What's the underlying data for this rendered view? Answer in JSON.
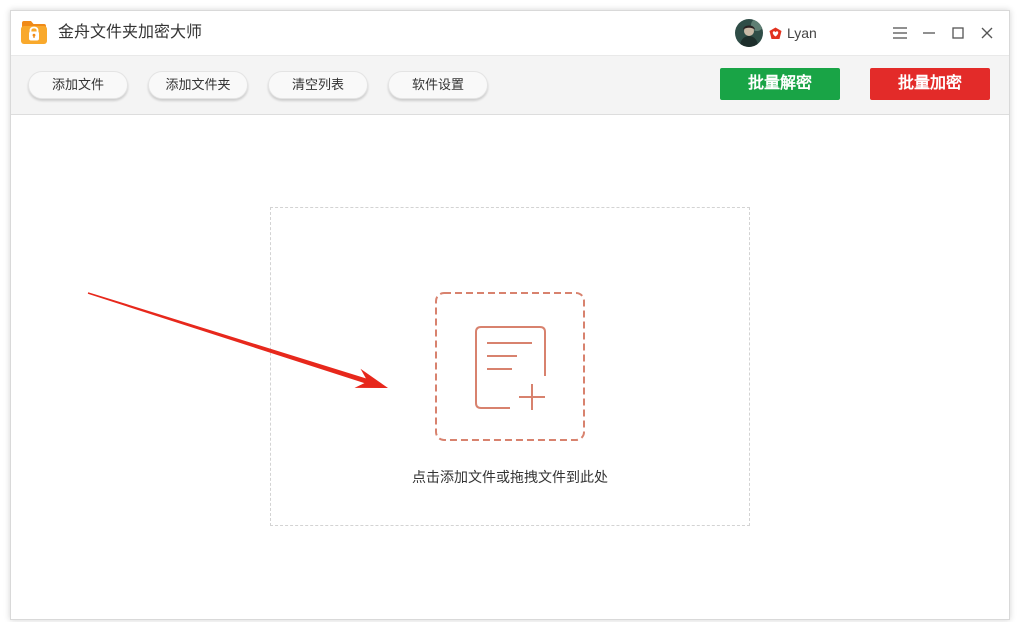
{
  "window": {
    "title": "金舟文件夹加密大师",
    "username": "Lyan"
  },
  "toolbar": {
    "buttons": [
      {
        "label": "添加文件"
      },
      {
        "label": "添加文件夹"
      },
      {
        "label": "清空列表"
      },
      {
        "label": "软件设置"
      }
    ],
    "decrypt_label": "批量解密",
    "encrypt_label": "批量加密"
  },
  "dropzone": {
    "hint": "点击添加文件或拖拽文件到此处"
  },
  "icons": {
    "app": "folder-lock-icon",
    "vip": "vip-badge-icon",
    "menu": "menu-icon",
    "minimize": "minimize-icon",
    "maximize": "maximize-icon",
    "close": "close-icon",
    "dropzone": "add-file-icon"
  },
  "colors": {
    "decrypt_button": "#19a446",
    "encrypt_button": "#e32b29",
    "dropzone_accent": "#d8826e",
    "annotation_arrow": "#e7281c"
  }
}
